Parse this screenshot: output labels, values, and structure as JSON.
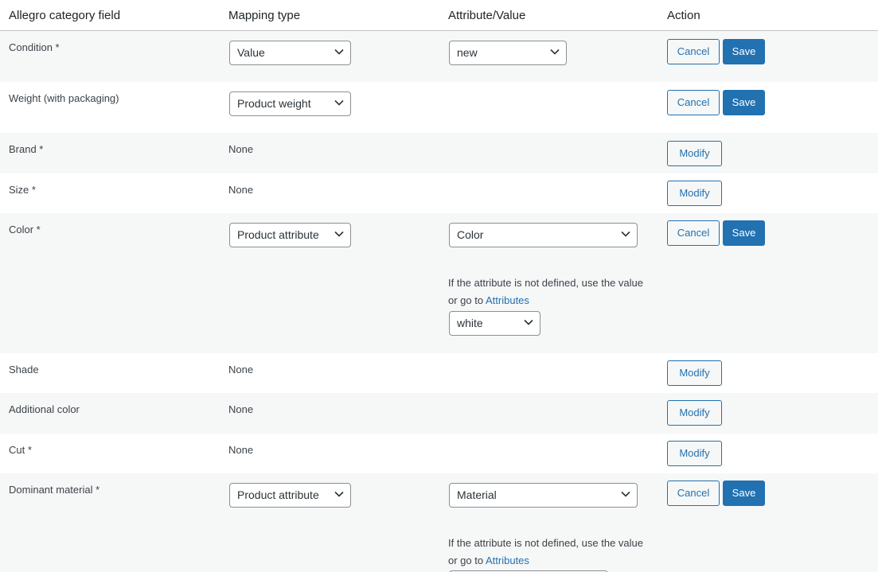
{
  "header": {
    "col_field": "Allegro category field",
    "col_mapping": "Mapping type",
    "col_attr": "Attribute/Value",
    "col_action": "Action"
  },
  "buttons": {
    "cancel": "Cancel",
    "save": "Save",
    "modify": "Modify"
  },
  "help": {
    "text": "If the attribute is not defined, use the value or go to",
    "link": "Attributes"
  },
  "rows": {
    "condition": {
      "label": "Condition *",
      "mapping": "Value",
      "value": "new"
    },
    "weight": {
      "label": "Weight (with packaging)",
      "mapping": "Product weight"
    },
    "brand": {
      "label": "Brand *",
      "mapping": "None"
    },
    "size": {
      "label": "Size *",
      "mapping": "None"
    },
    "color": {
      "label": "Color *",
      "mapping": "Product attribute",
      "attribute": "Color",
      "fallback": "white"
    },
    "shade": {
      "label": "Shade",
      "mapping": "None"
    },
    "additional_color": {
      "label": "Additional color",
      "mapping": "None"
    },
    "cut": {
      "label": "Cut *",
      "mapping": "None"
    },
    "dominant_material": {
      "label": "Dominant material *",
      "mapping": "Product attribute",
      "attribute": "Material"
    }
  },
  "icons": {
    "select_arrow": "chevron-down-icon"
  },
  "colors": {
    "primary": "#2271b1",
    "alt_row": "#f6f7f7",
    "border": "#8c8f94"
  }
}
